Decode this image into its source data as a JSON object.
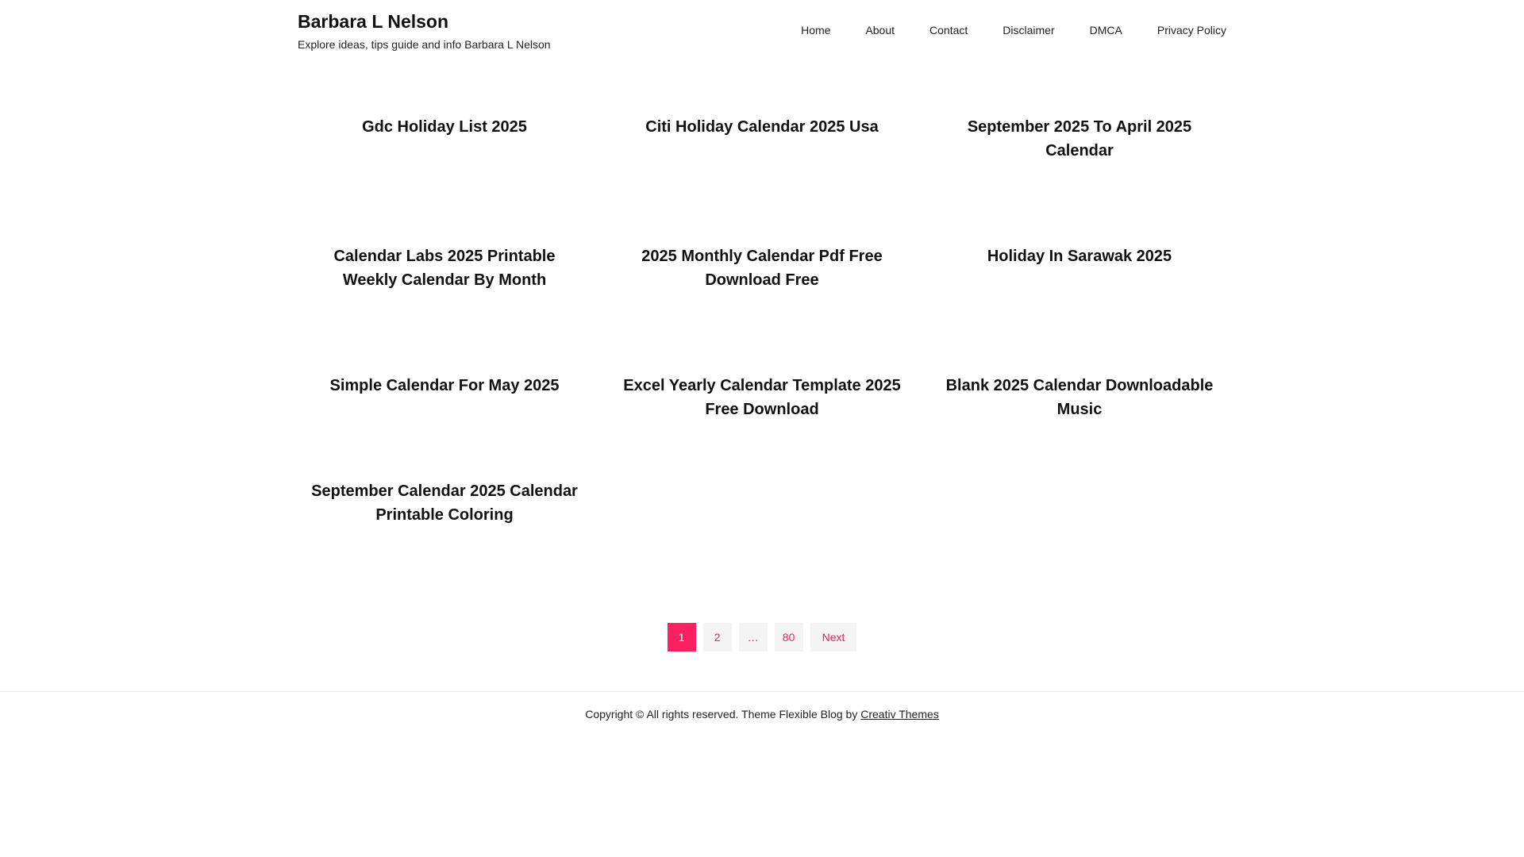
{
  "site": {
    "title": "Barbara L Nelson",
    "tagline": "Explore ideas, tips guide and info Barbara L Nelson"
  },
  "nav": {
    "items": [
      "Home",
      "About",
      "Contact",
      "Disclaimer",
      "DMCA",
      "Privacy Policy"
    ]
  },
  "posts": [
    "Gdc Holiday List 2025",
    "Citi Holiday Calendar 2025 Usa",
    "September 2025 To April 2025 Calendar",
    "Calendar Labs 2025 Printable Weekly Calendar By Month",
    "2025 Monthly Calendar Pdf Free Download Free",
    "Holiday In Sarawak 2025",
    "Simple Calendar For May 2025",
    "Excel Yearly Calendar Template 2025 Free Download",
    "Blank 2025 Calendar Downloadable Music",
    "September Calendar 2025 Calendar Printable Coloring"
  ],
  "pagination": {
    "current": "1",
    "page2": "2",
    "dots": "…",
    "last": "80",
    "next": "Next"
  },
  "footer": {
    "text": "Copyright © All rights reserved. Theme Flexible Blog by",
    "link": "Creativ Themes"
  },
  "colors": {
    "accent": "#fb2160",
    "page_bg": "#f4f4f4"
  }
}
